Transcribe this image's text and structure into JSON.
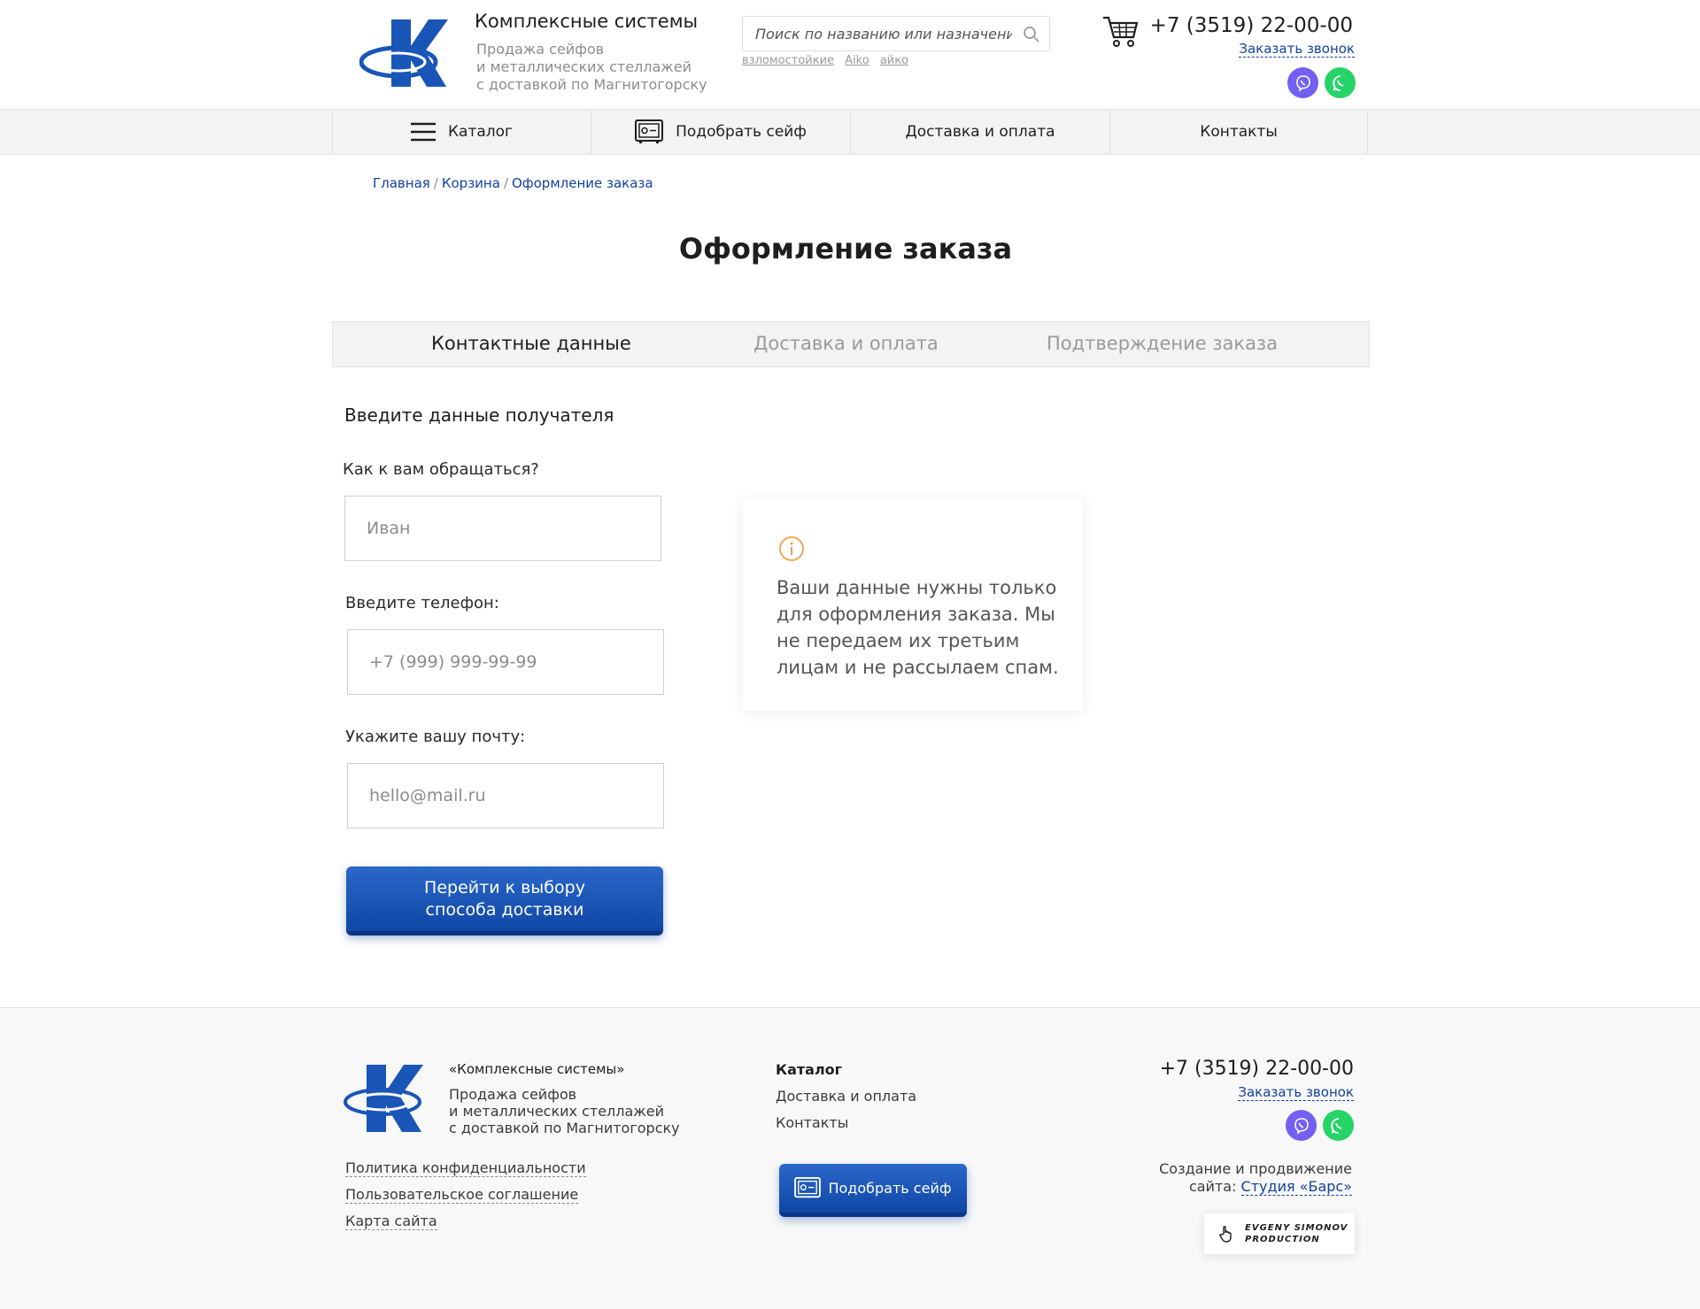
{
  "header": {
    "brand_name": "Комплексные системы",
    "brand_desc": "Продажа сейфов\nи металлических стеллажей\nс доставкой по Магнитогорску",
    "search_placeholder": "Поиск по названию или назначению",
    "search_tags": [
      "взломостойкие",
      "Aiko",
      "айко"
    ],
    "phone": "+7 (3519) 22-00-00",
    "callback": "Заказать звонок",
    "messengers": [
      "viber-icon",
      "whatsapp-icon"
    ]
  },
  "nav": {
    "items": [
      "Каталог",
      "Подобрать сейф",
      "Доставка и оплата",
      "Контакты"
    ]
  },
  "breadcrumb": [
    "Главная",
    "Корзина",
    "Оформление заказа"
  ],
  "page_title": "Оформление заказа",
  "steps": [
    {
      "label": "Контактные данные",
      "active": true
    },
    {
      "label": "Доставка и оплата",
      "active": false
    },
    {
      "label": "Подтверждение заказа",
      "active": false
    }
  ],
  "form": {
    "section_title": "Введите данные получателя",
    "name_label": "Как к вам обращаться?",
    "name_placeholder": "Иван",
    "phone_label": "Введите телефон:",
    "phone_placeholder": "+7 (999) 999-99-99",
    "email_label": "Укажите вашу почту:",
    "email_placeholder": "hello@mail.ru",
    "submit_label": "Перейти к выбору\nспособа доставки"
  },
  "info_card": {
    "text": "Ваши данные нужны только для оформления заказа. Мы не передаем их третьим лицам и не рассылаем спам."
  },
  "footer": {
    "brand": "«Комплексные системы»",
    "desc": "Продажа сейфов\nи металлических стеллажей\nс доставкой по Магнитогорску",
    "links": [
      "Политика конфиденциальности",
      "Пользовательское соглашение",
      "Карта сайта"
    ],
    "nav": [
      "Каталог",
      "Доставка и оплата",
      "Контакты"
    ],
    "pick_button": "Подобрать сейф",
    "phone": "+7 (3519) 22-00-00",
    "callback": "Заказать звонок",
    "promo_line1": "Создание и продвижение",
    "promo_line2_prefix": "сайта: ",
    "promo_link": "Студия «Барс»",
    "badge": "EVGENY SIMONOV\nPRODUCTION"
  },
  "colors": {
    "accent": "#12419d",
    "button": "#1a55b8",
    "info_icon": "#f0a04b",
    "viber": "#7360f2",
    "whatsapp": "#25d366"
  }
}
